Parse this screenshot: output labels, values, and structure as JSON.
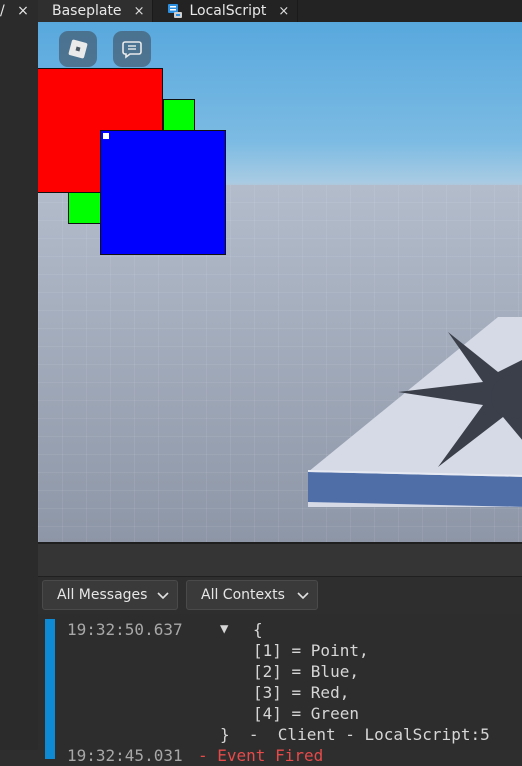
{
  "left_panel": {
    "glyph_a": "/",
    "glyph_b": "×"
  },
  "tabs": [
    {
      "label": "Baseplate",
      "close": "×",
      "active": true
    },
    {
      "label": "LocalScript",
      "close": "×",
      "active": false
    }
  ],
  "viewport": {
    "buttons": [
      "roblox-logo",
      "chat"
    ],
    "squares": [
      {
        "name": "green-square",
        "color": "#00ff00"
      },
      {
        "name": "red-square",
        "color": "#ff0000"
      },
      {
        "name": "blue-square",
        "color": "#0000ff"
      }
    ]
  },
  "output": {
    "filters": {
      "messages": "All Messages",
      "contexts": "All Contexts"
    },
    "entry": {
      "timestamp": "19:32:50.637",
      "toggle": "▼",
      "open_brace": "{",
      "items": [
        "[1] = Point,",
        "[2] = Blue,",
        "[3] = Red,",
        "[4] = Green"
      ],
      "close_line": "}  -  Client - LocalScript:5"
    },
    "next_entry": {
      "timestamp_partial": "19:32:45.031",
      "text_partial": "- Event Fired"
    }
  },
  "colors": {
    "accent_bar": "#0e8ad5",
    "tab_bg": "#232323"
  }
}
